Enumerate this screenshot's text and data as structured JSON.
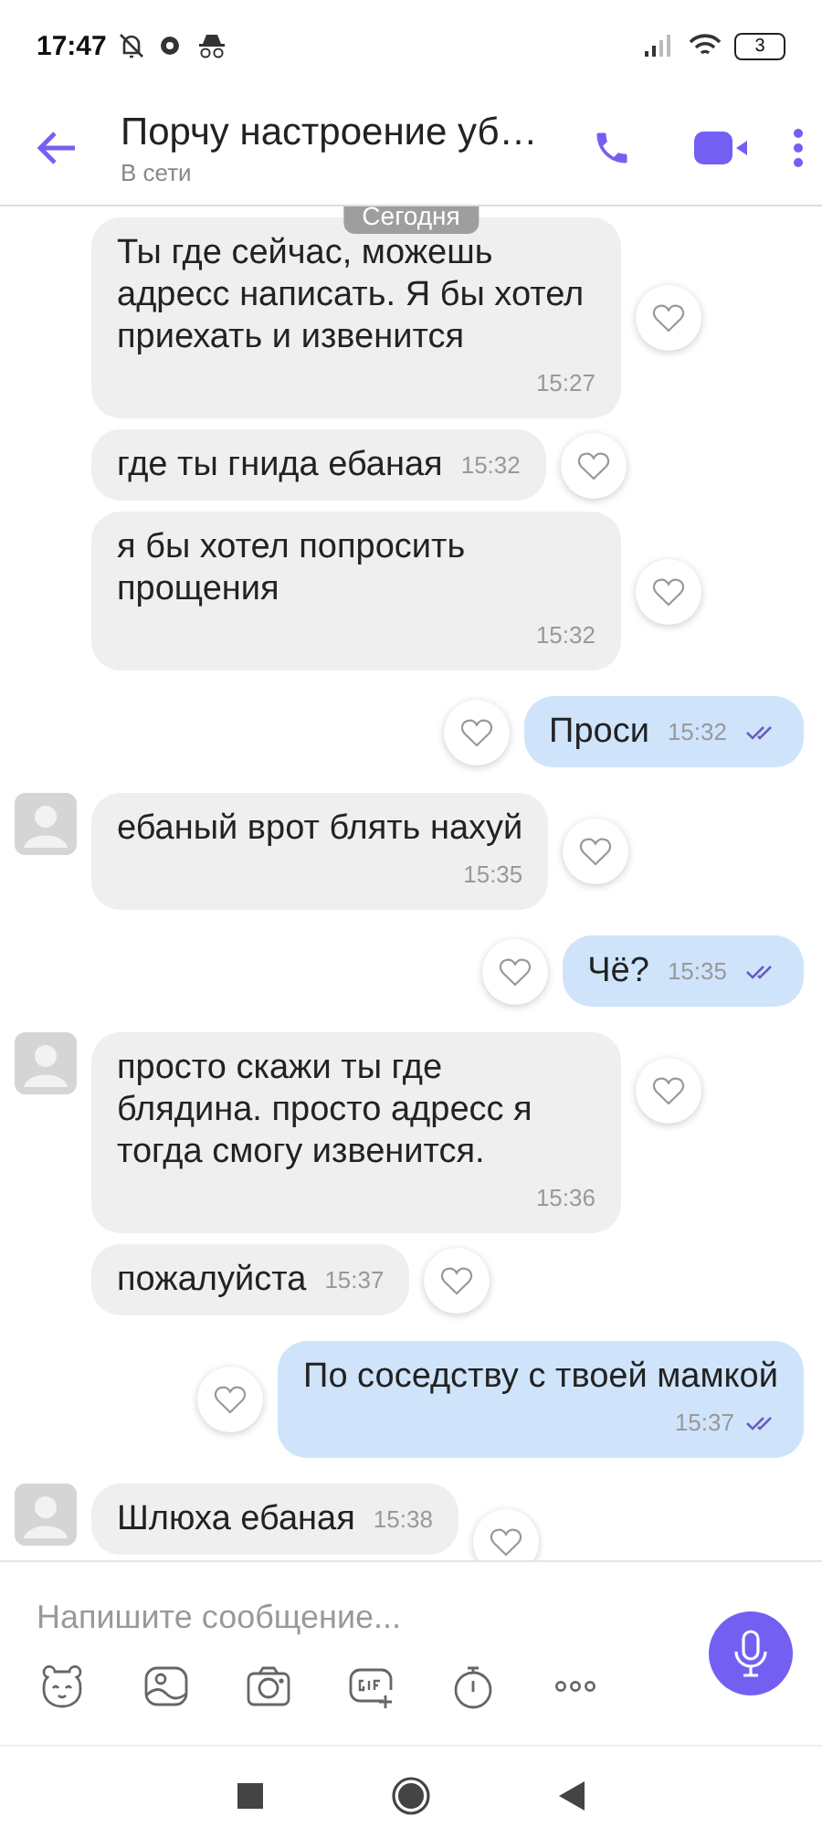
{
  "status_bar": {
    "time": "17:47",
    "battery": "3"
  },
  "header": {
    "title": "Порчу настроение уб…",
    "subtitle": "В сети"
  },
  "date_chip": "Сегодня",
  "messages": [
    {
      "kind": "incoming",
      "avatar": false,
      "text": "Ты где сейчас, можешь адресс написать. Я бы хотел приехать и извенится",
      "time": "15:27",
      "inline_time": false
    },
    {
      "kind": "incoming",
      "avatar": false,
      "text": "где ты гнида ебаная",
      "time": "15:32",
      "inline_time": true
    },
    {
      "kind": "incoming",
      "avatar": false,
      "text": "я бы хотел попросить прощения",
      "time": "15:32",
      "inline_time": false
    },
    {
      "kind": "outgoing",
      "text": "Проси",
      "time": "15:32",
      "inline_time": true,
      "read": true
    },
    {
      "kind": "incoming",
      "avatar": true,
      "text": "ебаный врот блять нахуй",
      "time": "15:35",
      "inline_time": false
    },
    {
      "kind": "outgoing",
      "text": "Чё?",
      "time": "15:35",
      "inline_time": true,
      "read": true
    },
    {
      "kind": "incoming",
      "avatar": true,
      "text": "просто скажи ты где блядина. просто адресс я тогда смогу извенится.",
      "time": "15:36",
      "inline_time": false
    },
    {
      "kind": "incoming",
      "avatar": false,
      "text": "пожалуйста",
      "time": "15:37",
      "inline_time": true
    },
    {
      "kind": "outgoing",
      "text": "По соседству с твоей мамкой",
      "time": "15:37",
      "inline_time": false,
      "read": true
    },
    {
      "kind": "incoming",
      "avatar": true,
      "text": "Шлюха ебаная",
      "time": "15:38",
      "inline_time": true
    }
  ],
  "composer": {
    "placeholder": "Напишите сообщение..."
  }
}
